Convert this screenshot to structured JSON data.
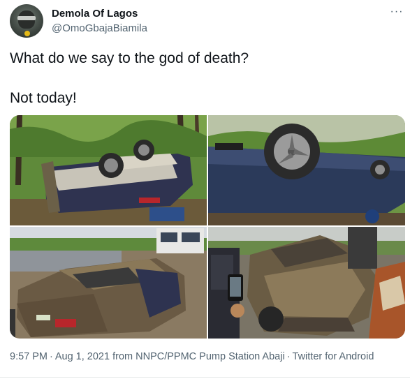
{
  "author": {
    "display_name": "Demola Of Lagos",
    "handle": "@OmoGbajaBiamila",
    "avatar_icon": "profile-avatar"
  },
  "menu": {
    "more_label": "···"
  },
  "tweet": {
    "line1": "What do we say to the god of death?",
    "line2": "Not today!"
  },
  "media": {
    "photos": [
      "overturned car in grass, top-left",
      "overturned car wheel close-up, top-right",
      "wrecked car on roadside, bottom-left",
      "crowd photographing crushed car, bottom-right"
    ]
  },
  "footer": {
    "time": "9:57 PM",
    "separator": "·",
    "date": "Aug 1, 2021",
    "location": "from NNPC/PPMC Pump Station Abaji",
    "client": "Twitter for Android"
  },
  "colors": {
    "text_primary": "#0f1419",
    "text_secondary": "#536471",
    "divider": "#e7e9ea"
  }
}
